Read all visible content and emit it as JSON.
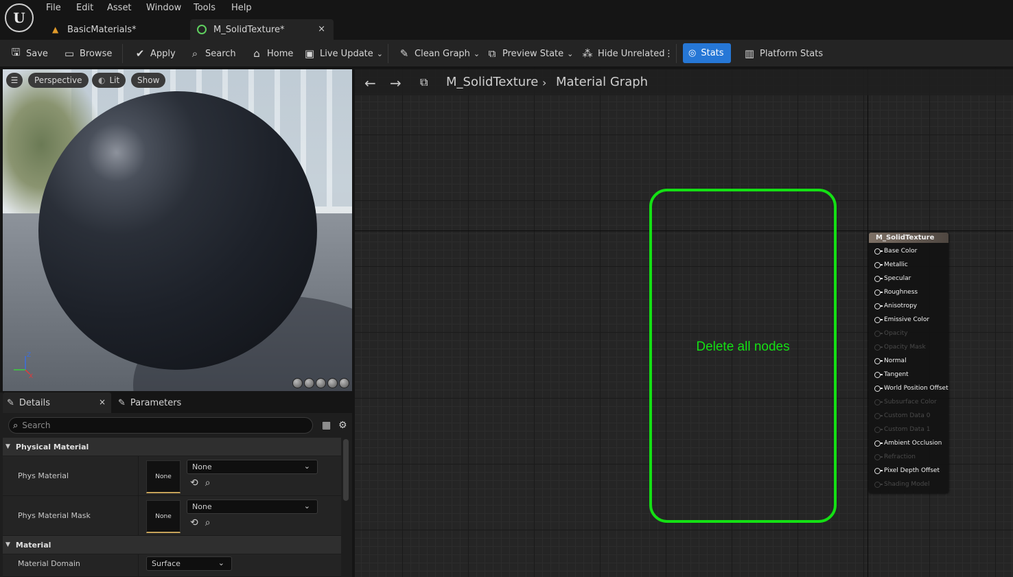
{
  "menu": {
    "items": [
      "File",
      "Edit",
      "Asset",
      "Window",
      "Tools",
      "Help"
    ]
  },
  "tabs": {
    "first": "BasicMaterials*",
    "second": "M_SolidTexture*",
    "close": "×"
  },
  "toolbar": {
    "save": "Save",
    "browse": "Browse",
    "apply": "Apply",
    "search": "Search",
    "home": "Home",
    "live_update": "Live Update",
    "clean_graph": "Clean Graph",
    "preview_state": "Preview State",
    "hide_unrelated": "Hide Unrelated",
    "stats": "Stats",
    "platform_stats": "Platform Stats",
    "accent_color": "#2677d6"
  },
  "viewport": {
    "perspective": "Perspective",
    "lit": "Lit",
    "show": "Show"
  },
  "details": {
    "tab_details": "Details",
    "tab_parameters": "Parameters",
    "search_placeholder": "Search",
    "categories": {
      "physical_material": "Physical Material",
      "material": "Material"
    },
    "props": {
      "phys_material": {
        "label": "Phys Material",
        "thumb": "None",
        "value": "None"
      },
      "phys_material_mask": {
        "label": "Phys Material Mask",
        "thumb": "None",
        "value": "None"
      },
      "material_domain": {
        "label": "Material Domain",
        "value": "Surface"
      }
    }
  },
  "graph": {
    "breadcrumb_asset": "M_SolidTexture",
    "breadcrumb_graph": "Material Graph",
    "annotation": "Delete all nodes",
    "annotation_color": "#14e014",
    "node": {
      "title": "M_SolidTexture",
      "pins": [
        {
          "label": "Base Color",
          "enabled": true
        },
        {
          "label": "Metallic",
          "enabled": true
        },
        {
          "label": "Specular",
          "enabled": true
        },
        {
          "label": "Roughness",
          "enabled": true
        },
        {
          "label": "Anisotropy",
          "enabled": true
        },
        {
          "label": "Emissive Color",
          "enabled": true
        },
        {
          "label": "Opacity",
          "enabled": false
        },
        {
          "label": "Opacity Mask",
          "enabled": false
        },
        {
          "label": "Normal",
          "enabled": true
        },
        {
          "label": "Tangent",
          "enabled": true
        },
        {
          "label": "World Position Offset",
          "enabled": true
        },
        {
          "label": "Subsurface Color",
          "enabled": false
        },
        {
          "label": "Custom Data 0",
          "enabled": false
        },
        {
          "label": "Custom Data 1",
          "enabled": false
        },
        {
          "label": "Ambient Occlusion",
          "enabled": true
        },
        {
          "label": "Refraction",
          "enabled": false
        },
        {
          "label": "Pixel Depth Offset",
          "enabled": true
        },
        {
          "label": "Shading Model",
          "enabled": false
        }
      ]
    }
  }
}
